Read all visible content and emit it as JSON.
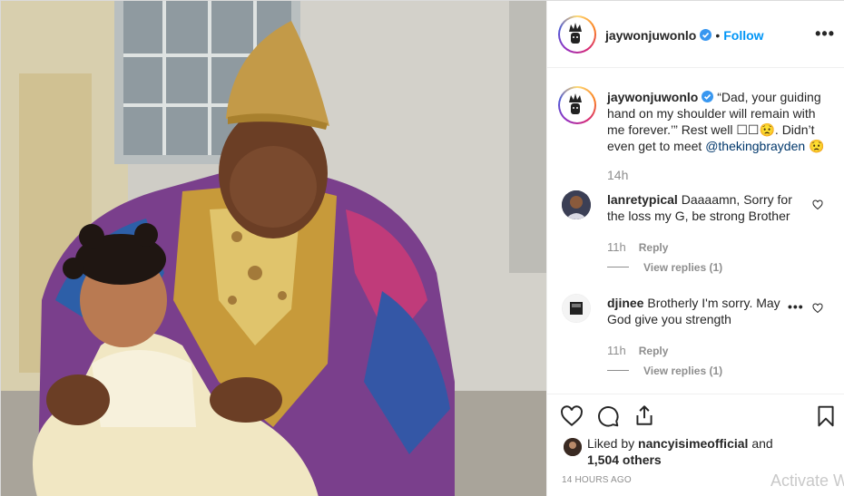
{
  "post": {
    "author": "jaywonjuwonlo",
    "verified": true,
    "separator": "•",
    "follow_label": "Follow",
    "more_label": "•••",
    "image_description_icon": "photo"
  },
  "caption": {
    "username": "jaywonjuwonlo",
    "text": "“Dad, your guiding hand on my shoulder will remain with me forever.’” Rest well ",
    "text_after_emoji": ". Didn’t even get to meet ",
    "emoji_squares": "☐☐",
    "emoji_sad": "😟",
    "mention": "@thekingbrayden",
    "emoji_end": "😟",
    "time": "14h"
  },
  "comments": [
    {
      "username": "lanretypical",
      "text": "Daaaamn, Sorry for the loss my G, be strong Brother",
      "time": "11h",
      "reply_label": "Reply",
      "view_replies": "View replies (1)"
    },
    {
      "username": "djinee",
      "text": "Brotherly I'm sorry. May God give you strength",
      "time": "11h",
      "reply_label": "Reply",
      "view_replies": "View replies (1)",
      "more_label": "•••"
    }
  ],
  "actions": {
    "liked_by_prefix": "Liked by ",
    "liked_by_user": "nancyisimeofficial",
    "liked_by_joiner": " and",
    "others": "1,504 others",
    "posted_ago": "14 HOURS AGO"
  },
  "overlay": {
    "watermark": "Activate W"
  },
  "colors": {
    "accent_blue": "#0095f6",
    "mention_blue": "#00376b",
    "muted_gray": "#8e8e8e",
    "text": "#262626"
  }
}
